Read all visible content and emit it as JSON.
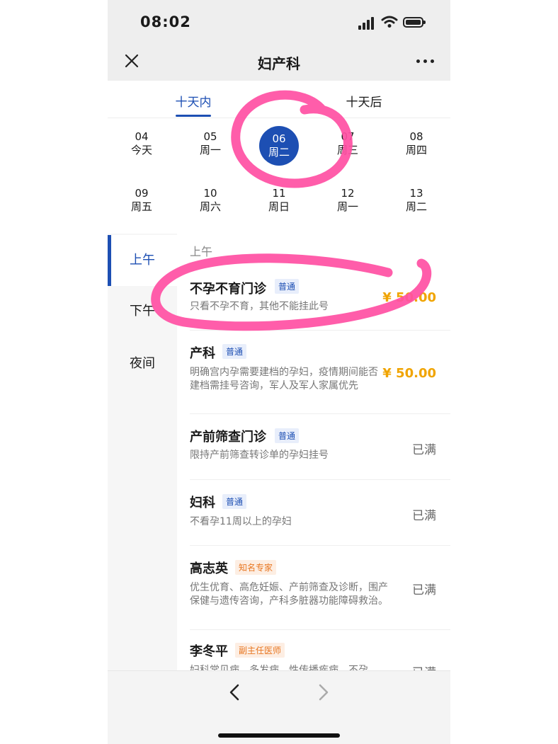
{
  "status_bar": {
    "time": "08:02"
  },
  "nav": {
    "title": "妇产科",
    "close_icon": "close-icon",
    "more_icon": "more-dots-icon"
  },
  "tabs": [
    {
      "label": "十天内",
      "active": true
    },
    {
      "label": "十天后",
      "active": false
    }
  ],
  "dates": [
    {
      "day": "04",
      "week": "今天"
    },
    {
      "day": "05",
      "week": "周一"
    },
    {
      "day": "06",
      "week": "周二",
      "selected": true
    },
    {
      "day": "07",
      "week": "周三"
    },
    {
      "day": "08",
      "week": "周四"
    },
    {
      "day": "09",
      "week": "周五"
    },
    {
      "day": "10",
      "week": "周六"
    },
    {
      "day": "11",
      "week": "周日"
    },
    {
      "day": "12",
      "week": "周一"
    },
    {
      "day": "13",
      "week": "周二"
    }
  ],
  "periods": [
    {
      "label": "上午",
      "active": true
    },
    {
      "label": "下午"
    },
    {
      "label": "夜间"
    }
  ],
  "section_header": "上午",
  "clinics": [
    {
      "name": "不孕不育门诊",
      "tag": "普通",
      "tag_color": "blue",
      "desc": "只看不孕不育，其他不能挂此号",
      "status": "¥ 50.00"
    },
    {
      "name": "产科",
      "tag": "普通",
      "tag_color": "blue",
      "desc": "明确宫内孕需要建档的孕妇，疫情期间能否建档需挂号咨询，军人及军人家属优先",
      "status": "¥ 50.00"
    },
    {
      "name": "产前筛查门诊",
      "tag": "普通",
      "tag_color": "blue",
      "desc": "限持产前筛查转诊单的孕妇挂号",
      "status": "已满"
    },
    {
      "name": "妇科",
      "tag": "普通",
      "tag_color": "blue",
      "desc": "不看孕11周以上的孕妇",
      "status": "已满"
    },
    {
      "name": "高志英",
      "tag": "知名专家",
      "tag_color": "orange",
      "desc": "优生优育、高危妊娠、产前筛查及诊断，围产保健与遗传咨询，产科多脏器功能障碍救治。",
      "status": "已满"
    },
    {
      "name": "李冬平",
      "tag": "副主任医师",
      "tag_color": "orange",
      "desc": "妇科常见病、多发病、性传播疾病、不孕",
      "status": "已满"
    }
  ],
  "colors": {
    "accent": "#1d4fb3",
    "price": "#f0a400",
    "annotation": "#ff4fa3"
  }
}
